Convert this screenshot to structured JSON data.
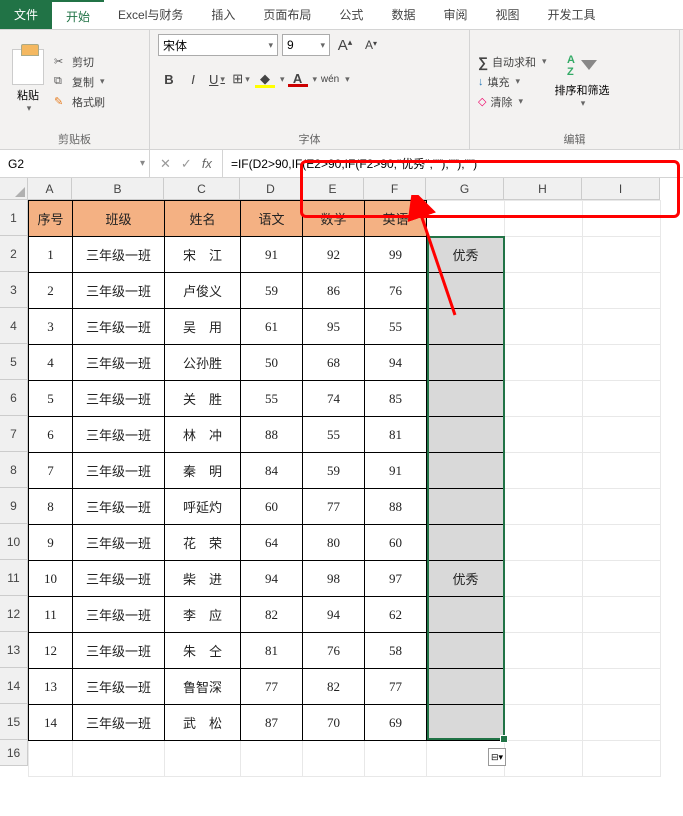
{
  "tabs": {
    "file": "文件",
    "home": "开始",
    "excel_fin": "Excel与财务",
    "insert": "插入",
    "page_layout": "页面布局",
    "formulas": "公式",
    "data": "数据",
    "review": "审阅",
    "view": "视图",
    "developer": "开发工具"
  },
  "ribbon": {
    "clipboard": {
      "paste": "粘贴",
      "cut": "剪切",
      "copy": "复制",
      "format_painter": "格式刷",
      "label": "剪贴板"
    },
    "font": {
      "name": "宋体",
      "size": "9",
      "label": "字体",
      "bold": "B",
      "italic": "I",
      "underline": "U",
      "inc_a": "A",
      "dec_a": "A",
      "wen": "wén"
    },
    "edit": {
      "autosum": "自动求和",
      "fill": "填充",
      "clear": "清除",
      "sort_filter": "排序和筛选",
      "label": "编辑"
    }
  },
  "namebox": "G2",
  "formula": "=IF(D2>90,IF(E2>90,IF(F2>90,\"优秀\",\"\"),\"\"),\"\")",
  "columns": [
    "A",
    "B",
    "C",
    "D",
    "E",
    "F",
    "G",
    "H",
    "I"
  ],
  "headers": {
    "A": "序号",
    "B": "班级",
    "C": "姓名",
    "D": "语文",
    "E": "数学",
    "F": "英语"
  },
  "rows": [
    {
      "n": "1",
      "cls": "三年级一班",
      "name": "宋　江",
      "d": "91",
      "e": "92",
      "f": "99",
      "g": "优秀"
    },
    {
      "n": "2",
      "cls": "三年级一班",
      "name": "卢俊义",
      "d": "59",
      "e": "86",
      "f": "76",
      "g": ""
    },
    {
      "n": "3",
      "cls": "三年级一班",
      "name": "吴　用",
      "d": "61",
      "e": "95",
      "f": "55",
      "g": ""
    },
    {
      "n": "4",
      "cls": "三年级一班",
      "name": "公孙胜",
      "d": "50",
      "e": "68",
      "f": "94",
      "g": ""
    },
    {
      "n": "5",
      "cls": "三年级一班",
      "name": "关　胜",
      "d": "55",
      "e": "74",
      "f": "85",
      "g": ""
    },
    {
      "n": "6",
      "cls": "三年级一班",
      "name": "林　冲",
      "d": "88",
      "e": "55",
      "f": "81",
      "g": ""
    },
    {
      "n": "7",
      "cls": "三年级一班",
      "name": "秦　明",
      "d": "84",
      "e": "59",
      "f": "91",
      "g": ""
    },
    {
      "n": "8",
      "cls": "三年级一班",
      "name": "呼延灼",
      "d": "60",
      "e": "77",
      "f": "88",
      "g": ""
    },
    {
      "n": "9",
      "cls": "三年级一班",
      "name": "花　荣",
      "d": "64",
      "e": "80",
      "f": "60",
      "g": ""
    },
    {
      "n": "10",
      "cls": "三年级一班",
      "name": "柴　进",
      "d": "94",
      "e": "98",
      "f": "97",
      "g": "优秀"
    },
    {
      "n": "11",
      "cls": "三年级一班",
      "name": "李　应",
      "d": "82",
      "e": "94",
      "f": "62",
      "g": ""
    },
    {
      "n": "12",
      "cls": "三年级一班",
      "name": "朱　仝",
      "d": "81",
      "e": "76",
      "f": "58",
      "g": ""
    },
    {
      "n": "13",
      "cls": "三年级一班",
      "name": "鲁智深",
      "d": "77",
      "e": "82",
      "f": "77",
      "g": ""
    },
    {
      "n": "14",
      "cls": "三年级一班",
      "name": "武　松",
      "d": "87",
      "e": "70",
      "f": "69",
      "g": ""
    }
  ],
  "icons": {
    "sigma": "∑",
    "down_arrow_ic": "↓",
    "eraser": "◇"
  }
}
